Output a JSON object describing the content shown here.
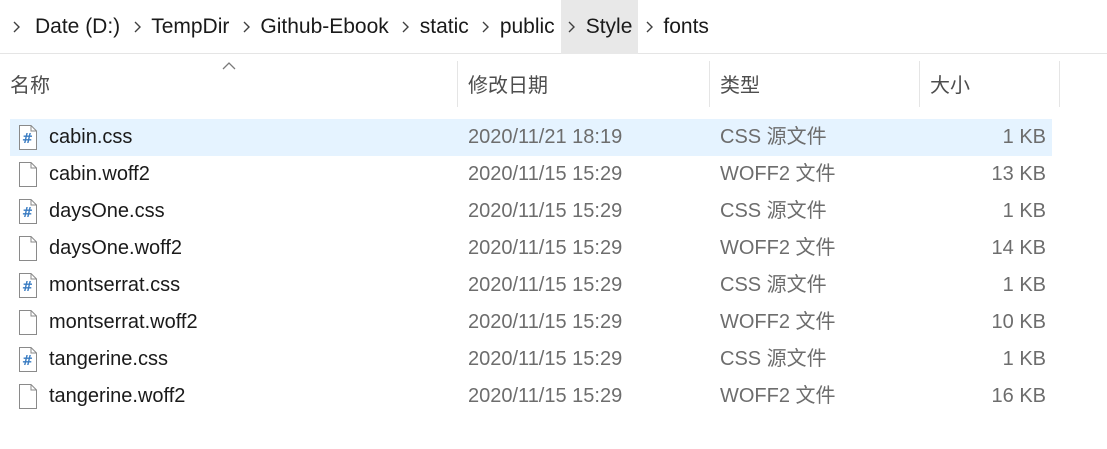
{
  "breadcrumb": {
    "items": [
      {
        "label": "Date (D:)"
      },
      {
        "label": "TempDir"
      },
      {
        "label": "Github-Ebook"
      },
      {
        "label": "static"
      },
      {
        "label": "public"
      },
      {
        "label": "Style"
      },
      {
        "label": "fonts"
      }
    ],
    "active_index": 5
  },
  "columns": {
    "name": "名称",
    "date": "修改日期",
    "type": "类型",
    "size": "大小"
  },
  "files": [
    {
      "name": "cabin.css",
      "date": "2020/11/21 18:19",
      "type": "CSS 源文件",
      "size": "1 KB",
      "icon": "css-file-icon",
      "selected": true
    },
    {
      "name": "cabin.woff2",
      "date": "2020/11/15 15:29",
      "type": "WOFF2 文件",
      "size": "13 KB",
      "icon": "blank-file-icon",
      "selected": false
    },
    {
      "name": "daysOne.css",
      "date": "2020/11/15 15:29",
      "type": "CSS 源文件",
      "size": "1 KB",
      "icon": "css-file-icon",
      "selected": false
    },
    {
      "name": "daysOne.woff2",
      "date": "2020/11/15 15:29",
      "type": "WOFF2 文件",
      "size": "14 KB",
      "icon": "blank-file-icon",
      "selected": false
    },
    {
      "name": "montserrat.css",
      "date": "2020/11/15 15:29",
      "type": "CSS 源文件",
      "size": "1 KB",
      "icon": "css-file-icon",
      "selected": false
    },
    {
      "name": "montserrat.woff2",
      "date": "2020/11/15 15:29",
      "type": "WOFF2 文件",
      "size": "10 KB",
      "icon": "blank-file-icon",
      "selected": false
    },
    {
      "name": "tangerine.css",
      "date": "2020/11/15 15:29",
      "type": "CSS 源文件",
      "size": "1 KB",
      "icon": "css-file-icon",
      "selected": false
    },
    {
      "name": "tangerine.woff2",
      "date": "2020/11/15 15:29",
      "type": "WOFF2 文件",
      "size": "16 KB",
      "icon": "blank-file-icon",
      "selected": false
    }
  ],
  "colors": {
    "selection": "#e5f3ff",
    "css_icon_accent": "#3a7cc2",
    "secondary_text": "#6d6d6d"
  }
}
